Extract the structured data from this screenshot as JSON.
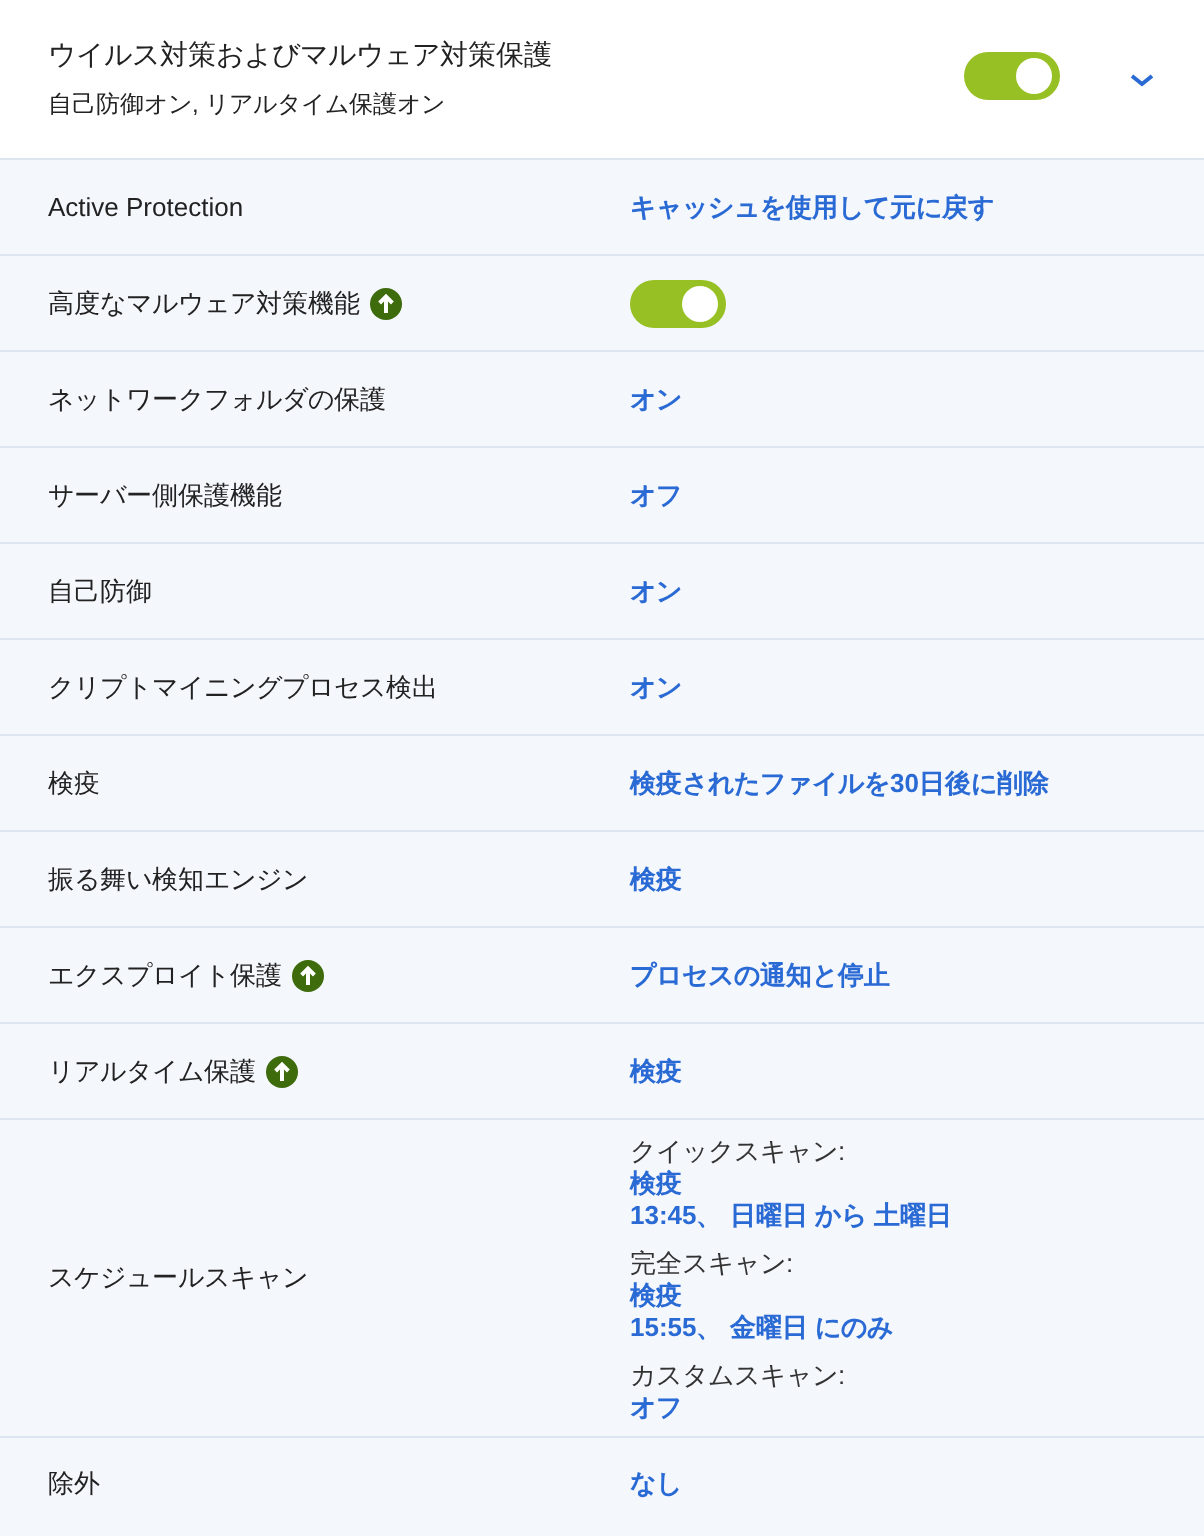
{
  "header": {
    "title": "ウイルス対策およびマルウェア対策保護",
    "subtitle": "自己防御オン, リアルタイム保護オン",
    "toggle": {
      "on": true
    }
  },
  "rows": [
    {
      "kind": "link",
      "label": "Active Protection",
      "upgrade": false,
      "value": "キャッシュを使用して元に戻す"
    },
    {
      "kind": "toggle",
      "label": "高度なマルウェア対策機能",
      "upgrade": true,
      "on": true
    },
    {
      "kind": "link",
      "label": "ネットワークフォルダの保護",
      "upgrade": false,
      "value": "オン"
    },
    {
      "kind": "link",
      "label": "サーバー側保護機能",
      "upgrade": false,
      "value": "オフ"
    },
    {
      "kind": "link",
      "label": "自己防御",
      "upgrade": false,
      "value": "オン"
    },
    {
      "kind": "link",
      "label": "クリプトマイニングプロセス検出",
      "upgrade": false,
      "value": "オン"
    },
    {
      "kind": "link",
      "label": "検疫",
      "upgrade": false,
      "value": "検疫されたファイルを30日後に削除"
    },
    {
      "kind": "link",
      "label": "振る舞い検知エンジン",
      "upgrade": false,
      "value": "検疫"
    },
    {
      "kind": "link",
      "label": "エクスプロイト保護",
      "upgrade": true,
      "value": "プロセスの通知と停止"
    },
    {
      "kind": "link",
      "label": "リアルタイム保護",
      "upgrade": true,
      "value": "検疫"
    },
    {
      "kind": "schedule",
      "label": "スケジュールスキャン",
      "upgrade": false,
      "scans": [
        {
          "name": "クイックスキャン:",
          "lines": [
            "検疫",
            "13:45、 日曜日 から 土曜日"
          ]
        },
        {
          "name": "完全スキャン:",
          "lines": [
            "検疫",
            "15:55、 金曜日 にのみ"
          ]
        },
        {
          "name": "カスタムスキャン:",
          "lines": [
            "オフ"
          ]
        }
      ]
    },
    {
      "kind": "link",
      "label": "除外",
      "upgrade": false,
      "value": "なし"
    }
  ]
}
